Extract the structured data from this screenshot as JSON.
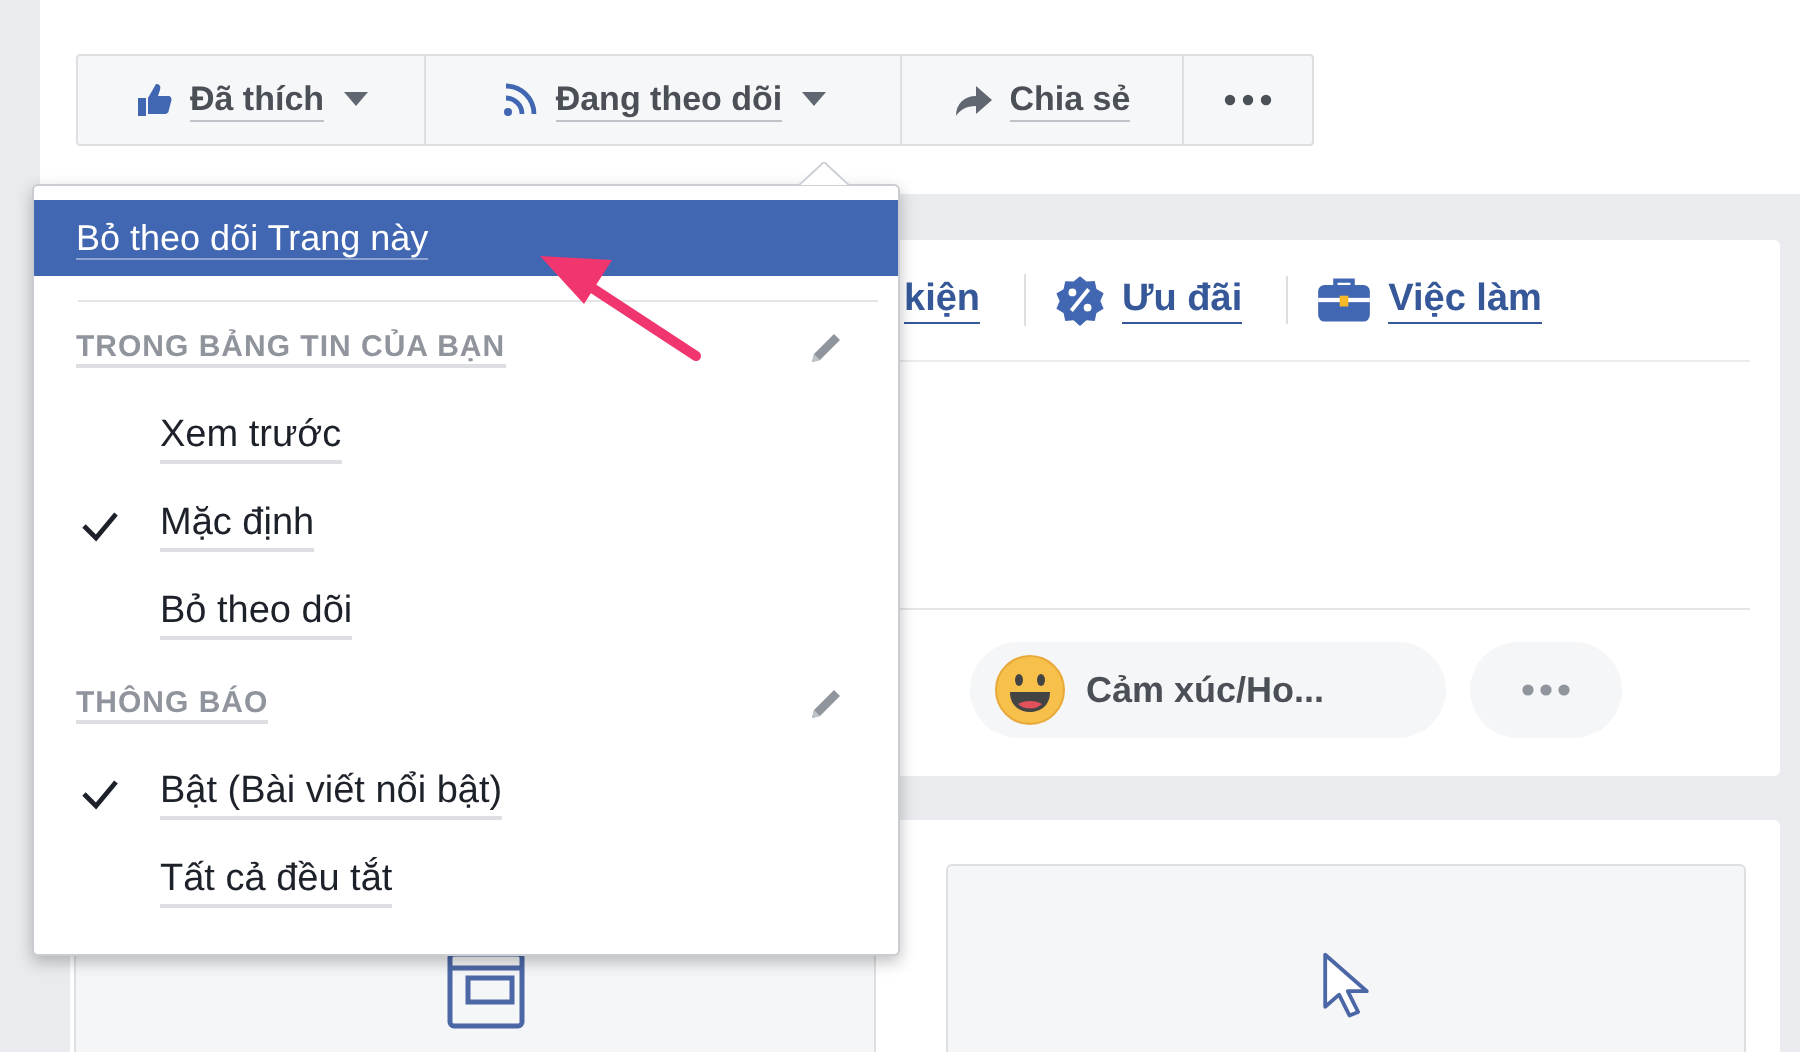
{
  "toolbar": {
    "buttons": [
      {
        "kind": "like",
        "label": "Đã thích",
        "dropdown": true
      },
      {
        "kind": "follow",
        "label": "Đang theo dõi",
        "dropdown": true
      },
      {
        "kind": "share",
        "label": "Chia sẻ",
        "dropdown": false
      },
      {
        "kind": "more",
        "dropdown": false
      }
    ]
  },
  "page_tabs": [
    {
      "kind": "plain",
      "label": "kiện"
    },
    {
      "kind": "offers",
      "label": "Ưu đãi"
    },
    {
      "kind": "jobs",
      "label": "Việc làm"
    }
  ],
  "composer": {
    "chips": [
      {
        "kind": "feeling",
        "label": "Cảm xúc/Ho..."
      },
      {
        "kind": "more"
      }
    ]
  },
  "menu": {
    "items": [
      {
        "kind": "action",
        "label": "Bỏ theo dõi Trang này",
        "selected": true
      },
      {
        "kind": "header",
        "label": "TRONG BẢNG TIN CỦA BẠN",
        "editable": true
      },
      {
        "kind": "option",
        "label": "Xem trước",
        "checked": false
      },
      {
        "kind": "option",
        "label": "Mặc định",
        "checked": true
      },
      {
        "kind": "option",
        "label": "Bỏ theo dõi",
        "checked": false
      },
      {
        "kind": "header",
        "label": "THÔNG BÁO",
        "editable": true
      },
      {
        "kind": "option",
        "label": "Bật (Bài viết nổi bật)",
        "checked": true
      },
      {
        "kind": "option",
        "label": "Tất cả đều tắt",
        "checked": false
      }
    ]
  }
}
